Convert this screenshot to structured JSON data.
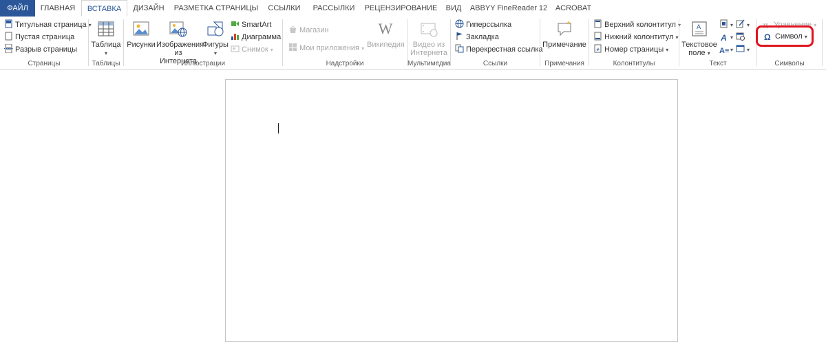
{
  "tabs": [
    "ФАЙЛ",
    "ГЛАВНАЯ",
    "ВСТАВКА",
    "ДИЗАЙН",
    "РАЗМЕТКА СТРАНИЦЫ",
    "ССЫЛКИ",
    "РАССЫЛКИ",
    "РЕЦЕНЗИРОВАНИЕ",
    "ВИД",
    "ABBYY FineReader 12",
    "ACROBAT"
  ],
  "groups": {
    "pages": {
      "label": "Страницы",
      "cover": "Титульная страница",
      "blank": "Пустая страница",
      "break": "Разрыв страницы"
    },
    "tables": {
      "label": "Таблицы",
      "table": "Таблица"
    },
    "illustrations": {
      "label": "Иллюстрации",
      "pictures": "Рисунки",
      "online_1": "Изображения",
      "online_2": "из Интернета",
      "shapes": "Фигуры",
      "smartart": "SmartArt",
      "chart": "Диаграмма",
      "screenshot": "Снимок"
    },
    "addins": {
      "label": "Надстройки",
      "store": "Магазин",
      "myapps": "Мои приложения",
      "wiki": "Википедия"
    },
    "media": {
      "label": "Мультимедиа",
      "video_1": "Видео из",
      "video_2": "Интернета"
    },
    "links": {
      "label": "Ссылки",
      "hyperlink": "Гиперссылка",
      "bookmark": "Закладка",
      "crossref": "Перекрестная ссылка"
    },
    "comments": {
      "label": "Примечания",
      "comment": "Примечание"
    },
    "headerfooter": {
      "label": "Колонтитулы",
      "header": "Верхний колонтитул",
      "footer": "Нижний колонтитул",
      "pagenum": "Номер страницы"
    },
    "text": {
      "label": "Текст",
      "textbox_1": "Текстовое",
      "textbox_2": "поле"
    },
    "symbols": {
      "label": "Символы",
      "equation": "Уравнение",
      "symbol": "Символ"
    }
  },
  "colors": {
    "file_tab": "#2b579a",
    "active_tab_text": "#2b579a",
    "highlight": "#e0141e"
  }
}
